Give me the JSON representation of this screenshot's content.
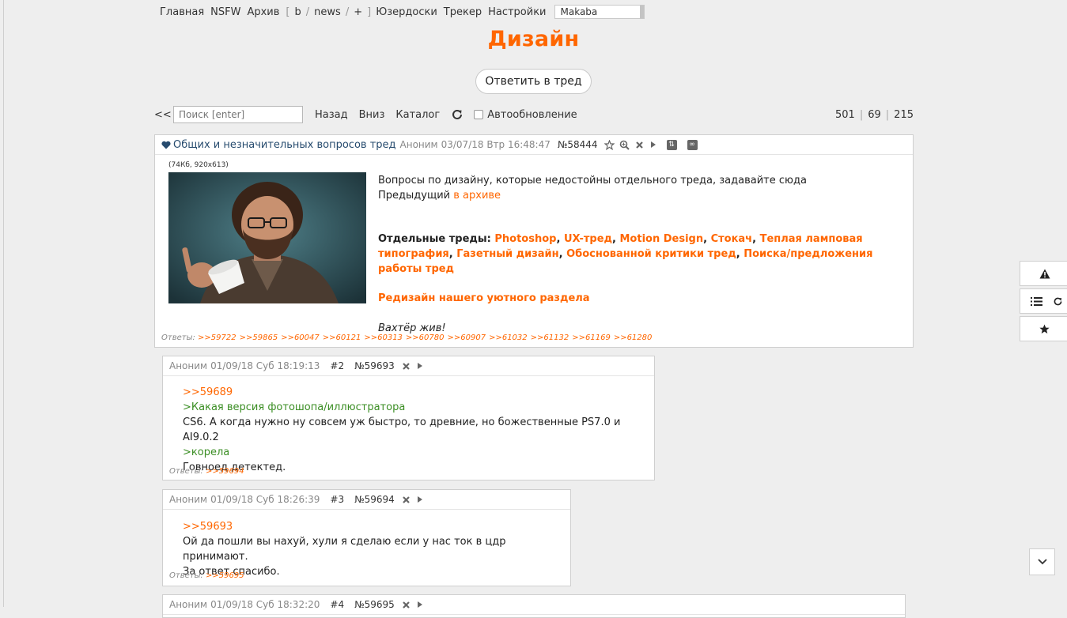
{
  "nav": {
    "items_left": [
      "Главная",
      "NSFW",
      "Архив"
    ],
    "bracket_open": "[",
    "bracket_close": "]",
    "boards": [
      "b",
      "news",
      "+"
    ],
    "board_sep": "/",
    "items_right": [
      "Юзердоски",
      "Трекер",
      "Настройки"
    ],
    "style_select": "Makaba"
  },
  "board_title": "Дизайн",
  "reply_button": "Ответить в тред",
  "toolbar": {
    "back": "<<",
    "search_placeholder": "Поиск [enter]",
    "links": [
      "Назад",
      "Вниз",
      "Каталог"
    ],
    "autoupdate_label": "Автообновление",
    "stats": [
      "501",
      "69",
      "215"
    ],
    "stats_sep": "|"
  },
  "op": {
    "subject": "Общих и незначительных вопросов тред",
    "name": "Аноним",
    "date": "03/07/18 Втр 16:48:47",
    "num": "№58444",
    "file_meta": "(74Кб, 920x613)",
    "line1": "Вопросы по дизайну, которые недостойны отдельного треда, задавайте сюда",
    "line2_text": "Предыдущий ",
    "line2_link": "в архиве",
    "separate_label": "Отдельные треды:",
    "separate_links": [
      "Photoshop",
      "UX-тред",
      "Motion Design",
      "Стокач",
      "Теплая ламповая типография",
      "Газетный дизайн",
      "Обоснованной критики тред",
      "Поиска/предложения работы тред"
    ],
    "redesign_link": "Редизайн нашего уютного раздела",
    "closing": "Вахтёр жив!",
    "replies_label": "Ответы:",
    "replies": [
      ">>59722",
      ">>59865",
      ">>60047",
      ">>60121",
      ">>60313",
      ">>60780",
      ">>60907",
      ">>61032",
      ">>61132",
      ">>61169",
      ">>61280"
    ]
  },
  "posts": [
    {
      "name": "Аноним",
      "date": "01/09/18 Суб 18:19:13",
      "ord": "#2",
      "num": "№59693",
      "quote": ">>59689",
      "green1": ">Какая версия фотошопа/иллюстратора",
      "text1": "CS6. А когда нужно ну совсем уж быстро, то древние, но божественные PS7.0 и AI9.0.2",
      "green2": ">корела",
      "text2": "Говноед детектед.",
      "replies_label": "Ответы:",
      "replies": [
        ">>59694"
      ]
    },
    {
      "name": "Аноним",
      "date": "01/09/18 Суб 18:26:39",
      "ord": "#3",
      "num": "№59694",
      "quote": ">>59693",
      "text1": "Ой да пошли вы нахуй, хули я сделаю если у нас ток в цдр принимают.",
      "text2": "За ответ спасибо.",
      "replies_label": "Ответы:",
      "replies": [
        ">>59695"
      ]
    },
    {
      "name": "Аноним",
      "date": "01/09/18 Суб 18:32:20",
      "ord": "#4",
      "num": "№59695"
    }
  ],
  "icons": {
    "heart": "heart-icon",
    "star": "star-icon",
    "search": "magnify-icon",
    "hide": "close-icon",
    "expand": "play-arrow-icon",
    "sort": "sort-icon",
    "infinity": "infinity-icon",
    "warning": "warning-icon",
    "list": "list-icon",
    "refresh": "refresh-icon",
    "favorite": "star-icon",
    "scroll": "chevron-down-icon"
  },
  "colors": {
    "accent": "#ff6600",
    "greentext": "#3b8e24",
    "subject": "#264b6e",
    "background": "#eeeeee"
  }
}
